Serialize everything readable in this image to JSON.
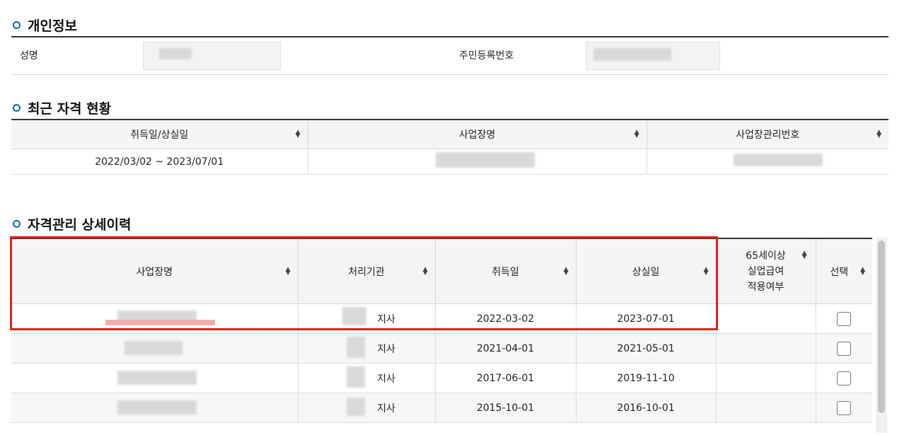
{
  "personal": {
    "title": "개인정보",
    "name_label": "성명",
    "ssn_label": "주민등록번호"
  },
  "recent": {
    "title": "최근 자격 현황",
    "columns": [
      "취득일/상실일",
      "사업장명",
      "사업장관리번호"
    ],
    "rows": [
      {
        "period": "2022/03/02 ~ 2023/07/01"
      }
    ]
  },
  "detail": {
    "title": "자격관리 상세이력",
    "columns": {
      "workplace": "사업장명",
      "agency": "처리기관",
      "acquired": "취득일",
      "lost": "상실일",
      "over65_line1": "65세이상",
      "over65_line2": "실업급여",
      "over65_line3": "적용여부",
      "select": "선택"
    },
    "rows": [
      {
        "agency_suffix": "지사",
        "acquired": "2022-03-02",
        "lost": "2023-07-01"
      },
      {
        "agency_suffix": "지사",
        "acquired": "2021-04-01",
        "lost": "2021-05-01"
      },
      {
        "agency_suffix": "지사",
        "acquired": "2017-06-01",
        "lost": "2019-11-10"
      },
      {
        "agency_suffix": "지사",
        "acquired": "2015-10-01",
        "lost": "2016-10-01"
      }
    ]
  },
  "sort_icon": "sort-updown-icon",
  "colors": {
    "accent": "#0c6e8f",
    "highlight": "#e0201a"
  }
}
